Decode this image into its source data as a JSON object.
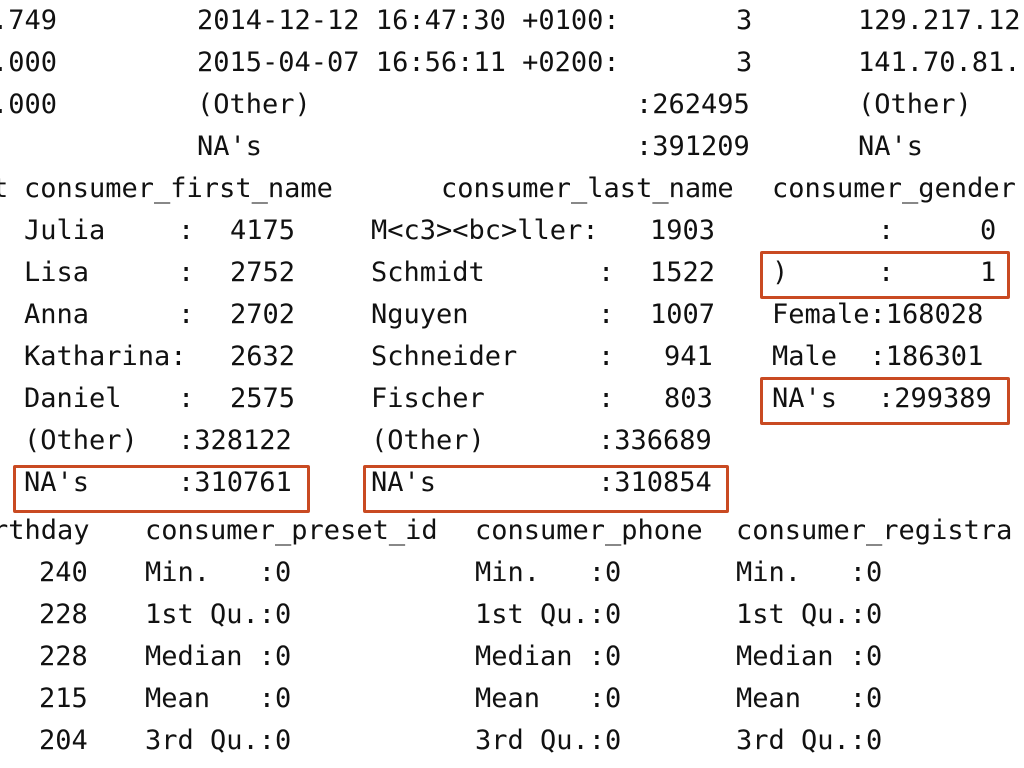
{
  "summary_top": {
    "rows": [
      [
        ".749",
        "2014-12-12 16:47:30 +0100:",
        "3",
        "129.217.12"
      ],
      [
        ".000",
        "2015-04-07 16:56:11 +0200:",
        "3",
        "141.70.81."
      ],
      [
        ".000",
        "(Other)",
        ":262495",
        "(Other)"
      ],
      [
        "",
        "NA's",
        ":391209",
        "NA's"
      ]
    ]
  },
  "summary_names": {
    "headers": [
      "t",
      "consumer_first_name",
      "consumer_last_name",
      "consumer_gender"
    ],
    "rows": [
      [
        "Julia",
        ":",
        "4175",
        "M<c3><bc>ller:",
        "1903",
        ":",
        "0"
      ],
      [
        "Lisa",
        ":",
        "2752",
        "Schmidt",
        ":",
        "1522",
        ")",
        ":",
        "1"
      ],
      [
        "Anna",
        ":",
        "2702",
        "Nguyen",
        ":",
        "1007",
        "Female:168028"
      ],
      [
        "Katharina:",
        "2632",
        "Schneider",
        ":",
        "941",
        "Male  :186301"
      ],
      [
        "Daniel",
        ":",
        "2575",
        "Fischer",
        ":",
        "803",
        "NA's",
        ":299389"
      ],
      [
        "(Other)",
        ":328122",
        "(Other)",
        ":336689"
      ],
      [
        "NA's",
        ":310761",
        "NA's",
        ":310854"
      ]
    ]
  },
  "summary_bottom": {
    "headers": [
      "rthday",
      "consumer_preset_id",
      "consumer_phone",
      "consumer_registra"
    ],
    "rows": [
      [
        "240",
        "Min.   :0",
        "Min.   :0",
        "Min.   :0"
      ],
      [
        "228",
        "1st Qu.:0",
        "1st Qu.:0",
        "1st Qu.:0"
      ],
      [
        "228",
        "Median :0",
        "Median :0",
        "Median :0"
      ],
      [
        "215",
        "Mean   :0",
        "Mean   :0",
        "Mean   :0"
      ],
      [
        "204",
        "3rd Qu.:0",
        "3rd Qu.:0",
        "3rd Qu.:0"
      ]
    ]
  },
  "colors": {
    "background": "#ffffff",
    "text": "#111111",
    "highlight": "#c94a22"
  }
}
